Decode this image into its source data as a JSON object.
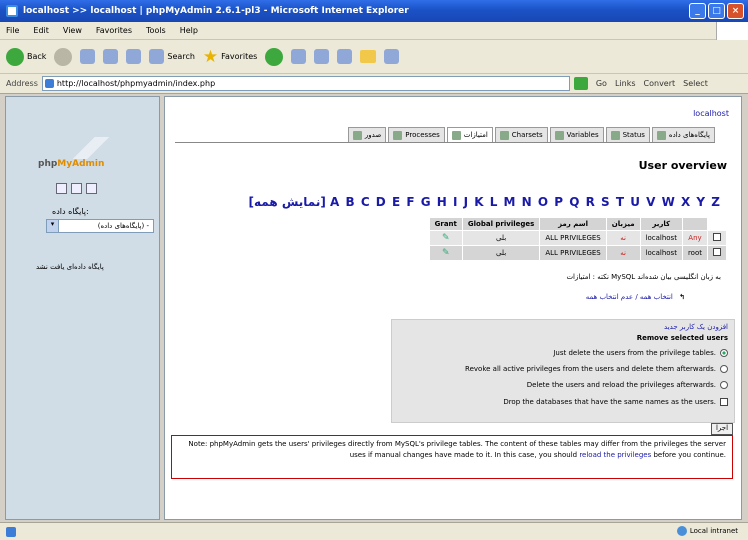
{
  "window": {
    "title": "localhost >> localhost | phpMyAdmin 2.6.1-pl3 - Microsoft Internet Explorer"
  },
  "menu": [
    "File",
    "Edit",
    "View",
    "Favorites",
    "Tools",
    "Help"
  ],
  "toolbar": {
    "back": "Back",
    "search": "Search",
    "favorites": "Favorites"
  },
  "address": {
    "label": "Address",
    "url": "http://localhost/phpmyadmin/index.php",
    "go": "Go",
    "links": "Links",
    "convert": "Convert",
    "select": "Select"
  },
  "sidebar": {
    "logo_php": "php",
    "logo_myadmin": "MyAdmin",
    "db_label": "پایگاه داده:",
    "db_select": "(پایگاه‌های داده) -",
    "no_db": "پایگاه داده‌ای یافت نشد"
  },
  "main": {
    "server_link": "localhost",
    "tabs": [
      {
        "label": "پایگاه‌های داده",
        "active": false
      },
      {
        "label": "Status",
        "active": false
      },
      {
        "label": "Variables",
        "active": false
      },
      {
        "label": "Charsets",
        "active": false
      },
      {
        "label": "امتیازات",
        "active": true
      },
      {
        "label": "Processes",
        "active": false
      },
      {
        "label": "صدور",
        "active": false
      }
    ],
    "user_overview": "User overview",
    "alphabet": "A B C D E F G H I J K L M N O P Q R S T U V W X Y Z",
    "show_all": "[نمایش همه]",
    "table": {
      "headers": [
        "کاربر",
        "میزبان",
        "اسم رمز",
        "Global privileges",
        "Grant"
      ],
      "rows": [
        {
          "user": "Any",
          "host": "localhost",
          "password": "نه",
          "privs": "ALL PRIVILEGES",
          "grant": "بلی"
        },
        {
          "user": "root",
          "host": "localhost",
          "password": "نه",
          "privs": "ALL PRIVILEGES",
          "grant": "بلی"
        }
      ]
    },
    "note": "نکته : امتیازات MySQL به زبان انگلیسی بیان شده‌اند",
    "select_all": "انتخاب همه / عدم انتخاب همه",
    "add_user": "افزودن یک کاربر جدید",
    "remove_title": "Remove selected users",
    "options": [
      "Just delete the users from the privilege tables.",
      "Revoke all active privileges from the users and delete them afterwards.",
      "Delete the users and reload the privileges afterwards.",
      "Drop the databases that have the same names as the users."
    ],
    "go_button": "اجرا",
    "warning_text": "Note: phpMyAdmin gets the users' privileges directly from MySQL's privilege tables. The content of these tables may differ from the privileges the server uses if manual changes have made to it. In this case, you should",
    "warning_link": "reload the privileges",
    "warning_tail": "before you continue."
  },
  "status": {
    "zone": "Local intranet"
  }
}
